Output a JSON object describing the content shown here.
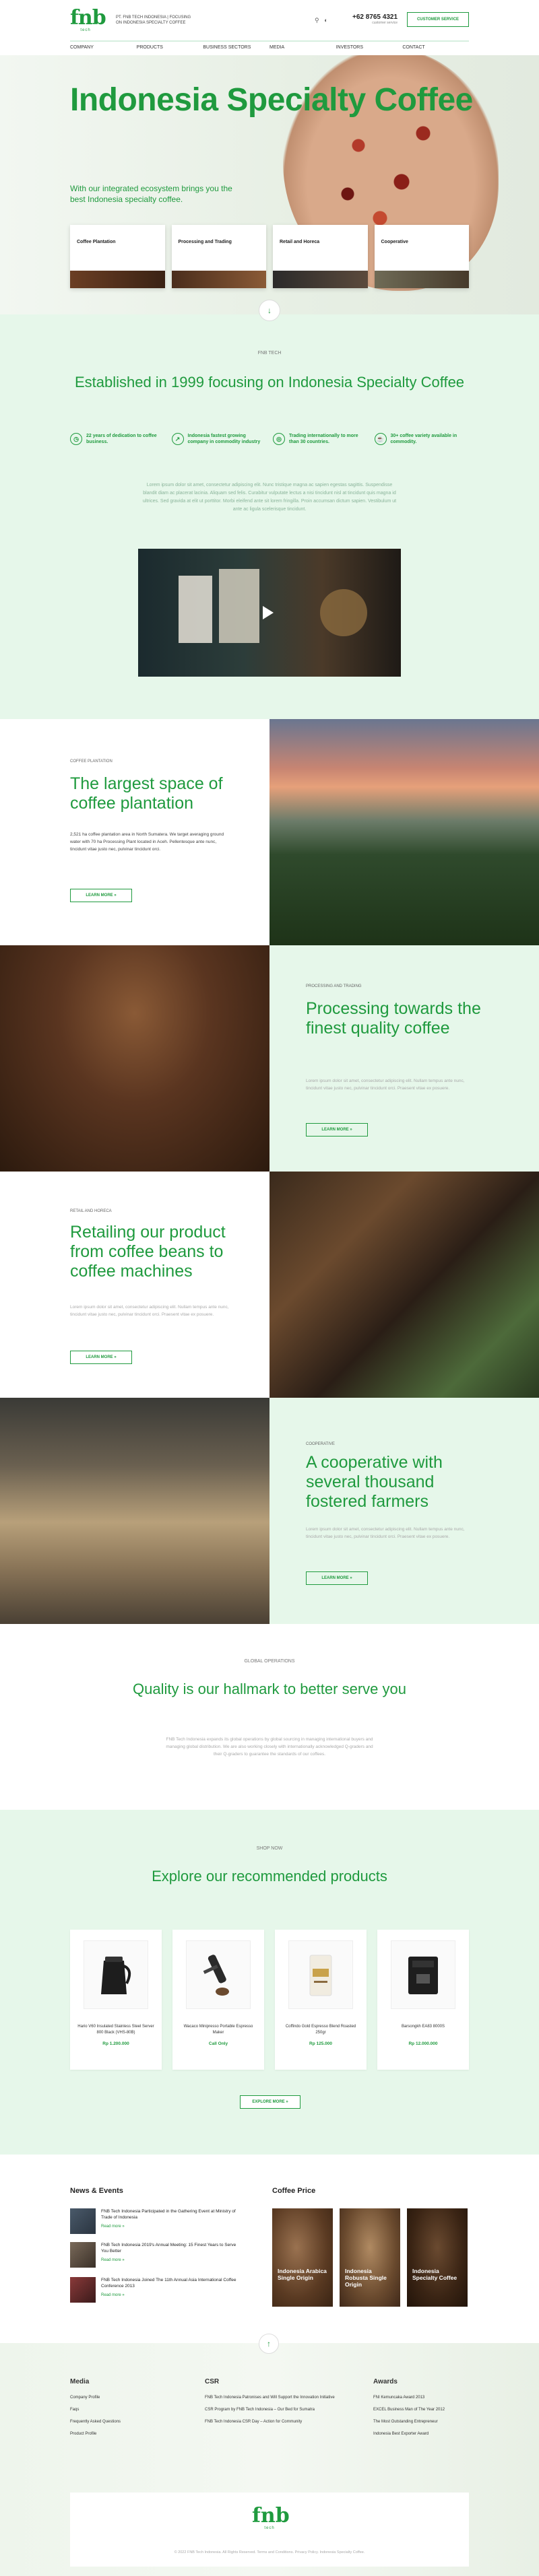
{
  "brand": {
    "logo_text": "fnb",
    "logo_sub": "tech",
    "tagline": "PT. FNB TECH INDONESIA | FOCUSING ON INDONESIA SPECIALTY COFFEE"
  },
  "top": {
    "phone": "+62 8765 4321",
    "phone_sub": "customer service",
    "cs_button": "CUSTOMER SERVICE"
  },
  "nav": [
    "COMPANY",
    "PRODUCTS",
    "BUSINESS SECTORS",
    "MEDIA",
    "INVESTORS",
    "CONTACT"
  ],
  "hero": {
    "title": "Indonesia Specialty Coffee",
    "subtitle": "With our integrated ecosystem brings you the best Indonesia specialty coffee.",
    "cards": [
      "Coffee Plantation",
      "Processing and Trading",
      "Retail and Horeca",
      "Cooperative"
    ]
  },
  "about": {
    "eyebrow": "FNB TECH",
    "title": "Established in 1999 focusing on Indonesia Specialty Coffee",
    "features": [
      {
        "icon": "calendar-icon",
        "text": "22 years of dedication to coffee business."
      },
      {
        "icon": "growth-icon",
        "text": "Indonesia fastest growing company in commodity industry"
      },
      {
        "icon": "globe-icon",
        "text": "Trading internationally to more than 30 countries."
      },
      {
        "icon": "coffee-icon",
        "text": "30+ coffee variety available in commodity."
      }
    ],
    "paragraph": "Lorem ipsum dolor sit amet, consectetur adipiscing elit. Nunc tristique magna ac sapien egestas sagittis. Suspendisse blandit diam ac placerat lacinia. Aliquam sed felis. Curabitur vulputate lectus a nisi tincidunt nisl at tincidunt quis magna id ultrices. Sed gravida at elit ut porttitor. Morbi eleifend ante sit lorem fringilla. Proin accumsan dictum sapien. Vestibulum ut ante ac ligula scelerisque tincidunt."
  },
  "sections": [
    {
      "eyebrow": "COFFEE PLANTATION",
      "title": "The largest space of coffee plantation",
      "body": "2,521 ha coffee plantation area in North Sumatera. We target averaging ground water with 70 ha Processing Plant located in Aceh. Pellentesque ante nunc, tincidunt vitae justo nec, pulvinar tincidunt orci.",
      "button": "LEARN MORE »"
    },
    {
      "eyebrow": "PROCESSING AND TRADING",
      "title": "Processing towards the finest quality coffee",
      "body": "Lorem ipsum dolor sit amet, consectetur adipiscing elit. Nullam tempus ante nunc, tincidunt vitae justo nec, pulvinar tincidunt orci. Praesent vitae ex posuere.",
      "button": "LEARN MORE »"
    },
    {
      "eyebrow": "RETAIL AND HORECA",
      "title": "Retailing our product from coffee beans to coffee machines",
      "body": "Lorem ipsum dolor sit amet, consectetur adipiscing elit. Nullam tempus ante nunc, tincidunt vitae justo nec, pulvinar tincidunt orci. Praesent vitae ex posuere.",
      "button": "LEARN MORE »"
    },
    {
      "eyebrow": "COOPERATIVE",
      "title": "A cooperative with several thousand fostered farmers",
      "body": "Lorem ipsum dolor sit amet, consectetur adipiscing elit. Nullam tempus ante nunc, tincidunt vitae justo nec, pulvinar tincidunt orci. Praesent vitae ex posuere.",
      "button": "LEARN MORE »"
    }
  ],
  "quality": {
    "eyebrow": "GLOBAL OPERATIONS",
    "title": "Quality is our hallmark to better serve you",
    "paragraph": "FNB Tech Indonesia expands its global operations by global sourcing in managing international buyers and managing global distribution. We are also working closely with internationally acknowledged Q-graders and their Q-graders to guarantee the standards of our coffees."
  },
  "shop": {
    "eyebrow": "SHOP NOW",
    "title": "Explore our recommended products",
    "products": [
      {
        "name": "Hario V60 Insulated Stainless Steel Server 800 Black (VHS-80B)",
        "price": "Rp 1.200.000"
      },
      {
        "name": "Wacaco Minipresso Portable Espresso Maker",
        "price": "Call Only"
      },
      {
        "name": "Coffindo Gold Espresso Blend Roasted 250gr",
        "price": "Rp 125.000"
      },
      {
        "name": "Barsongkh EA83 8000S",
        "price": "Rp 12.000.000"
      }
    ],
    "explore_button": "EXPLORE MORE »"
  },
  "news": {
    "title": "News & Events",
    "items": [
      {
        "title": "FNB Tech Indonesia Participated in the Gathering Event at Ministry of Trade of Indonesia",
        "read": "Read more »"
      },
      {
        "title": "FNB Tech Indonesia 2019's Annual Meeting: 15 Finest Years to Serve You Better",
        "read": "Read more »"
      },
      {
        "title": "FNB Tech Indonesia Joined The 11th Annual Asia International Coffee Conference 2013",
        "read": "Read more »"
      }
    ]
  },
  "coffee_price": {
    "title": "Coffee Price",
    "items": [
      "Indonesia Arabica Single Origin",
      "Indonesia Robusta Single Origin",
      "Indonesia Specialty Coffee"
    ]
  },
  "footer": {
    "columns": [
      {
        "title": "Media",
        "items": [
          "Company Profile",
          "Faqs",
          "Frequently Asked Questions",
          "Product Profile"
        ]
      },
      {
        "title": "CSR",
        "items": [
          "FNB Tech Indonesia Patronises and Will Support the Innovation Initiative",
          "CSR Program by FNB Tech Indonesia – Our Bed for Sumatra",
          "FNB Tech Indonesia CSR Day – Action for Community"
        ]
      },
      {
        "title": "Awards",
        "items": [
          "FNI Kemuncaka Award 2013",
          "EXCEL Business Man of The Year 2012",
          "The Most Outstanding Entrepreneur",
          "Indonesia Best Exporter Award"
        ]
      }
    ],
    "copyright": "© 2022 FNB Tech Indonesia. All Rights Reserved. Terms and Conditions. Privacy Policy. Indonesia Specialty Coffee."
  }
}
